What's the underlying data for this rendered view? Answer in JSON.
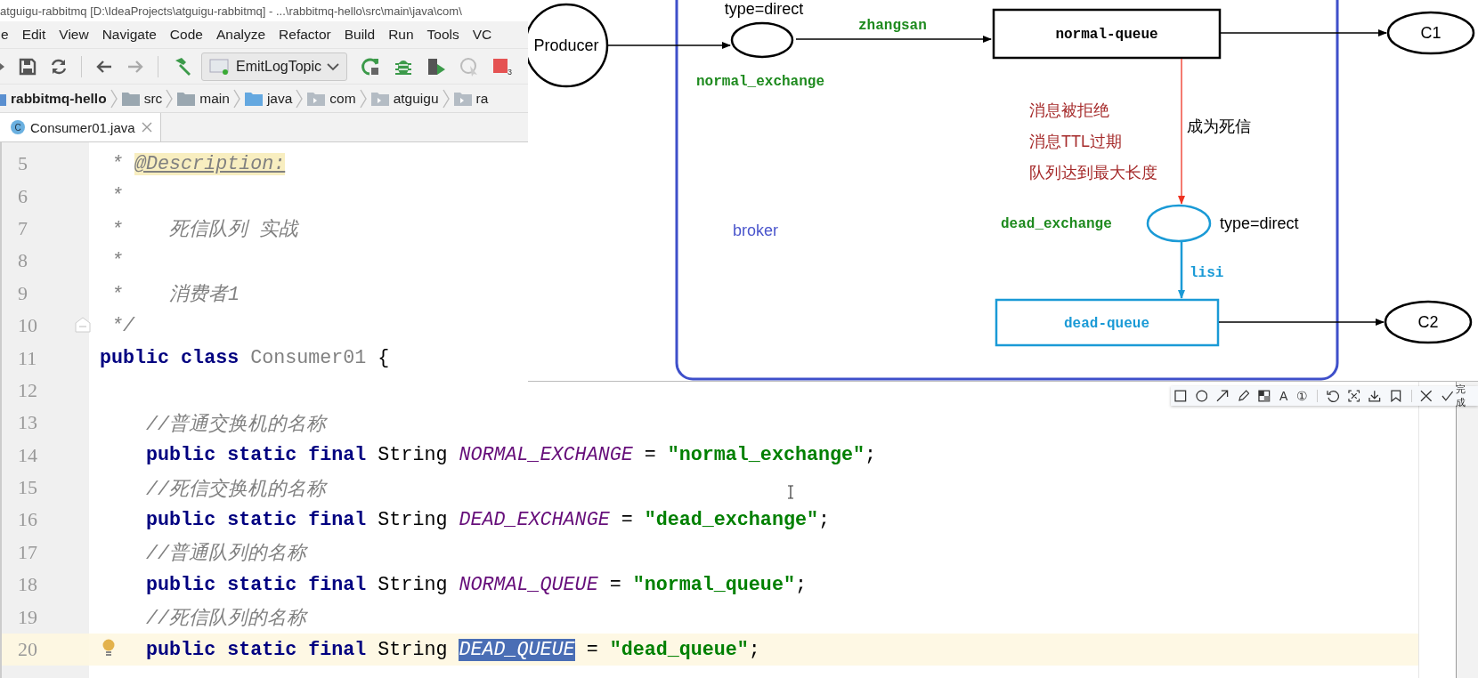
{
  "window": {
    "title": "atguigu-rabbitmq [D:\\IdeaProjects\\atguigu-rabbitmq] - ...\\rabbitmq-hello\\src\\main\\java\\com\\"
  },
  "menu": [
    "e",
    "Edit",
    "View",
    "Navigate",
    "Code",
    "Analyze",
    "Refactor",
    "Build",
    "Run",
    "Tools",
    "VC"
  ],
  "toolbar": {
    "run_config": "EmitLogTopic",
    "stop_badge": "3"
  },
  "breadcrumb": [
    {
      "label": "rabbitmq-hello",
      "kind": "module"
    },
    {
      "label": "src",
      "kind": "folder"
    },
    {
      "label": "main",
      "kind": "folder"
    },
    {
      "label": "java",
      "kind": "source"
    },
    {
      "label": "com",
      "kind": "package"
    },
    {
      "label": "atguigu",
      "kind": "package"
    },
    {
      "label": "ra",
      "kind": "package"
    }
  ],
  "tabs": [
    {
      "label": "Consumer01.java",
      "icon_letter": "C",
      "selected": true
    }
  ],
  "editor": {
    "lines": [
      {
        "number": "5",
        "current": false,
        "fold": false,
        "tokens": [
          {
            "kind": "comment",
            "text": " * "
          },
          {
            "kind": "doctag",
            "text": "@Description:"
          }
        ]
      },
      {
        "number": "6",
        "current": false,
        "fold": false,
        "tokens": [
          {
            "kind": "comment",
            "text": " *"
          }
        ]
      },
      {
        "number": "7",
        "current": false,
        "fold": false,
        "tokens": [
          {
            "kind": "comment",
            "text": " *    死信队列 实战"
          }
        ]
      },
      {
        "number": "8",
        "current": false,
        "fold": false,
        "tokens": [
          {
            "kind": "comment",
            "text": " *"
          }
        ]
      },
      {
        "number": "9",
        "current": false,
        "fold": false,
        "tokens": [
          {
            "kind": "comment",
            "text": " *    消费者1"
          }
        ]
      },
      {
        "number": "10",
        "current": false,
        "fold": true,
        "tokens": [
          {
            "kind": "comment",
            "text": " */"
          }
        ]
      },
      {
        "number": "11",
        "current": false,
        "fold": false,
        "tokens": [
          {
            "kind": "keyword",
            "text": "public class"
          },
          {
            "kind": "classname",
            "text": " Consumer01"
          },
          {
            "kind": "plain",
            "text": " {"
          }
        ]
      },
      {
        "number": "12",
        "current": false,
        "fold": false
      },
      {
        "number": "13",
        "current": false,
        "fold": false,
        "tokens": [
          {
            "kind": "comment",
            "text": "    //普通交换机的名称"
          }
        ]
      },
      {
        "number": "14",
        "current": false,
        "fold": false,
        "tokens": [
          {
            "kind": "keyword",
            "text": "    public static final"
          },
          {
            "kind": "plain",
            "text": " String "
          },
          {
            "kind": "constant",
            "text": "NORMAL_EXCHANGE"
          },
          {
            "kind": "plain",
            "text": " = "
          },
          {
            "kind": "string",
            "text": "\"normal_exchange\""
          },
          {
            "kind": "plain",
            "text": ";"
          }
        ]
      },
      {
        "number": "15",
        "current": false,
        "fold": false,
        "tokens": [
          {
            "kind": "comment",
            "text": "    //死信交换机的名称"
          }
        ]
      },
      {
        "number": "16",
        "current": false,
        "fold": false,
        "tokens": [
          {
            "kind": "keyword",
            "text": "    public static final"
          },
          {
            "kind": "plain",
            "text": " String "
          },
          {
            "kind": "constant",
            "text": "DEAD_EXCHANGE"
          },
          {
            "kind": "plain",
            "text": " = "
          },
          {
            "kind": "string",
            "text": "\"dead_exchange\""
          },
          {
            "kind": "plain",
            "text": ";"
          }
        ]
      },
      {
        "number": "17",
        "current": false,
        "fold": false,
        "tokens": [
          {
            "kind": "comment",
            "text": "    //普通队列的名称"
          }
        ]
      },
      {
        "number": "18",
        "current": false,
        "fold": false,
        "tokens": [
          {
            "kind": "keyword",
            "text": "    public static final"
          },
          {
            "kind": "plain",
            "text": " String "
          },
          {
            "kind": "constant",
            "text": "NORMAL_QUEUE"
          },
          {
            "kind": "plain",
            "text": " = "
          },
          {
            "kind": "string",
            "text": "\"normal_queue\""
          },
          {
            "kind": "plain",
            "text": ";"
          }
        ]
      },
      {
        "number": "19",
        "current": false,
        "fold": false,
        "tokens": [
          {
            "kind": "comment",
            "text": "    //死信队列的名称"
          }
        ]
      },
      {
        "number": "20",
        "current": true,
        "fold": false,
        "tokens": [
          {
            "kind": "keyword",
            "text": "    public static final"
          },
          {
            "kind": "plain",
            "text": " String "
          },
          {
            "kind": "selection",
            "text": "DEAD_QUEUE"
          },
          {
            "kind": "plain",
            "text": " = "
          },
          {
            "kind": "string",
            "text": "\"dead_queue\""
          },
          {
            "kind": "plain",
            "text": ";"
          }
        ]
      }
    ]
  },
  "diagram": {
    "producer": "Producer",
    "exchange_type_top": "type=direct",
    "normal_exchange": "normal_exchange",
    "routing_key_normal": "zhangsan",
    "normal_queue": "normal-queue",
    "consumer_1": "C1",
    "dead_reasons": [
      "消息被拒绝",
      "消息TTL过期",
      "队列达到最大长度"
    ],
    "dead_letter_label": "成为死信",
    "broker": "broker",
    "dead_exchange": "dead_exchange",
    "exchange_type_dead": "type=direct",
    "routing_key_dead": "lisi",
    "dead_queue": "dead-queue",
    "consumer_2": "C2"
  },
  "capture_toolbar": {
    "text_tool": "A",
    "step_tool": "①",
    "done": "完成"
  }
}
